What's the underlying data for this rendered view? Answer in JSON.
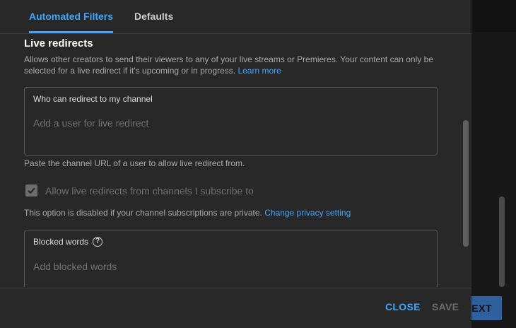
{
  "tabs": [
    {
      "label": "Automated Filters",
      "active": true
    },
    {
      "label": "Defaults",
      "active": false
    }
  ],
  "live_redirects": {
    "title": "Live redirects",
    "description": "Allows other creators to send their viewers to any of your live streams or Premieres. Your content can only be selected for a live redirect if it's upcoming or in progress.",
    "learn_more": "Learn more",
    "field_label": "Who can redirect to my channel",
    "field_placeholder": "Add a user for live redirect",
    "field_hint": "Paste the channel URL of a user to allow live redirect from.",
    "checkbox_label": "Allow live redirects from channels I subscribe to",
    "checkbox_checked": true,
    "checkbox_disabled": true,
    "disabled_note": "This option is disabled if your channel subscriptions are private.",
    "privacy_link": "Change privacy setting"
  },
  "blocked_words": {
    "label": "Blocked words",
    "help_icon": "?",
    "placeholder": "Add blocked words"
  },
  "footer": {
    "close_label": "CLOSE",
    "save_label": "SAVE"
  },
  "background": {
    "next_button_label": "EXT"
  },
  "colors": {
    "accent": "#3ea6ff",
    "dialog_bg": "#282828",
    "page_bg": "#1f1f1f"
  }
}
